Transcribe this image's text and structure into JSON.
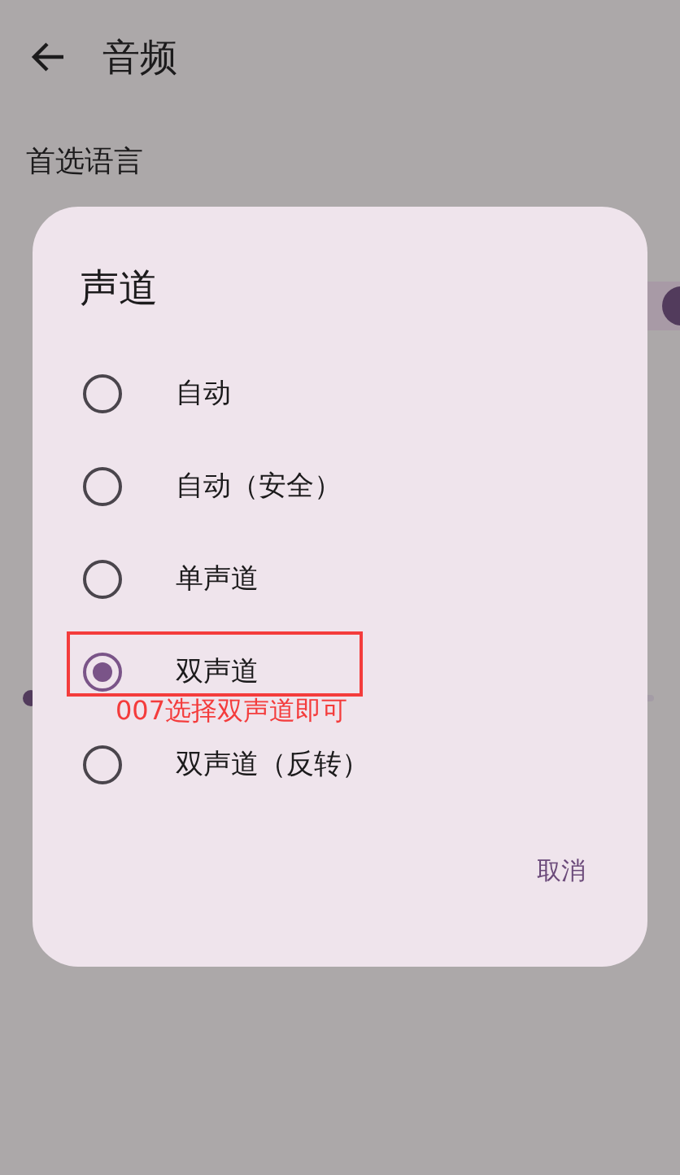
{
  "app_bar": {
    "title": "音频"
  },
  "settings": {
    "first_item": "首选语言",
    "switch": {
      "on": true
    },
    "slider": {
      "level": 0
    }
  },
  "dialog": {
    "title": "声道",
    "options": [
      {
        "label": "自动",
        "selected": false
      },
      {
        "label": "自动（安全）",
        "selected": false
      },
      {
        "label": "单声道",
        "selected": false
      },
      {
        "label": "双声道",
        "selected": true
      },
      {
        "label": "双声道（反转）",
        "selected": false
      }
    ],
    "cancel": "取消"
  },
  "annotation": {
    "text": "007选择双声道即可"
  }
}
